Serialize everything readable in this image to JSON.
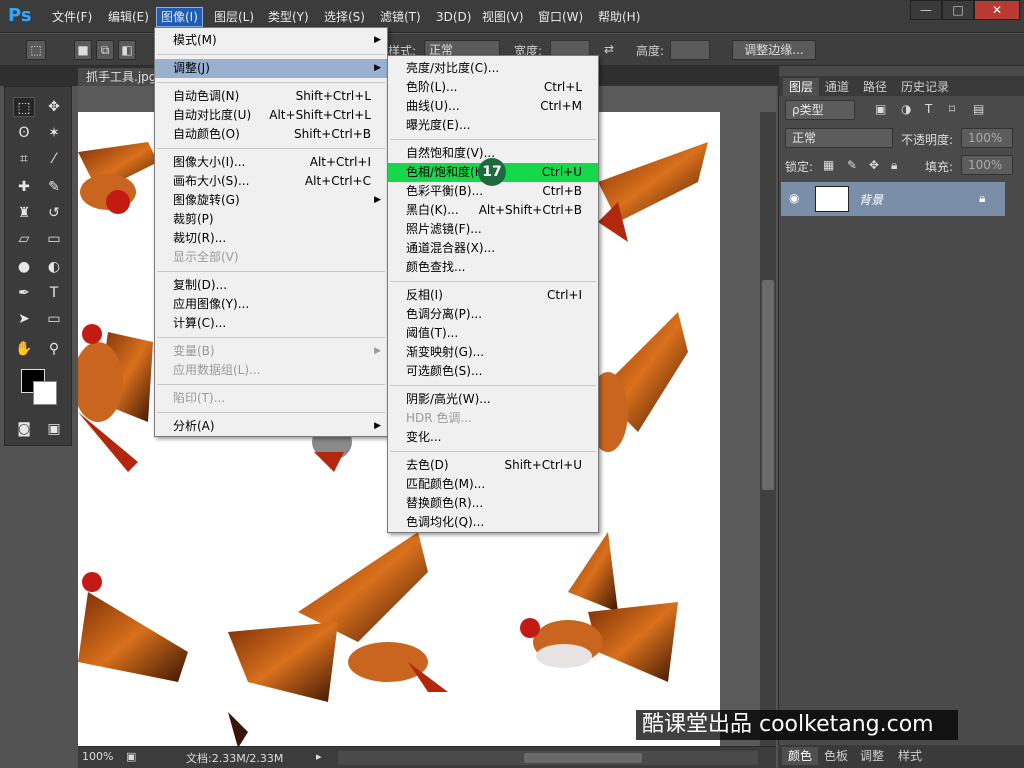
{
  "app": {
    "logo": "Ps"
  },
  "menubar": {
    "items": [
      "文件(F)",
      "编辑(E)",
      "图像(I)",
      "图层(L)",
      "类型(Y)",
      "选择(S)",
      "滤镜(T)",
      "3D(D)",
      "视图(V)",
      "窗口(W)",
      "帮助(H)"
    ],
    "active": "图像(I)"
  },
  "window_controls": {
    "minimize": "—",
    "maximize": "□",
    "close": "✕"
  },
  "options_bar": {
    "style_label": "样式:",
    "style_value": "正常",
    "width_label": "宽度:",
    "height_label": "高度:",
    "refine_button": "调整边缘..."
  },
  "document": {
    "tab_title": "抓手工具.jpg",
    "zoom": "100%",
    "doc_info": "文档:2.33M/2.33M"
  },
  "image_menu": {
    "items": [
      {
        "label": "模式(M)",
        "shortcut": "",
        "submenu": true,
        "disabled": false
      },
      {
        "sep": true
      },
      {
        "label": "调整(J)",
        "shortcut": "",
        "submenu": true,
        "disabled": false,
        "highlight": true
      },
      {
        "sep": true
      },
      {
        "label": "自动色调(N)",
        "shortcut": "Shift+Ctrl+L"
      },
      {
        "label": "自动对比度(U)",
        "shortcut": "Alt+Shift+Ctrl+L"
      },
      {
        "label": "自动颜色(O)",
        "shortcut": "Shift+Ctrl+B"
      },
      {
        "sep": true
      },
      {
        "label": "图像大小(I)...",
        "shortcut": "Alt+Ctrl+I"
      },
      {
        "label": "画布大小(S)...",
        "shortcut": "Alt+Ctrl+C"
      },
      {
        "label": "图像旋转(G)",
        "shortcut": "",
        "submenu": true
      },
      {
        "label": "裁剪(P)",
        "shortcut": ""
      },
      {
        "label": "裁切(R)...",
        "shortcut": ""
      },
      {
        "label": "显示全部(V)",
        "shortcut": "",
        "disabled": true
      },
      {
        "sep": true
      },
      {
        "label": "复制(D)...",
        "shortcut": ""
      },
      {
        "label": "应用图像(Y)...",
        "shortcut": ""
      },
      {
        "label": "计算(C)...",
        "shortcut": ""
      },
      {
        "sep": true
      },
      {
        "label": "变量(B)",
        "shortcut": "",
        "submenu": true,
        "disabled": true
      },
      {
        "label": "应用数据组(L)...",
        "shortcut": "",
        "disabled": true
      },
      {
        "sep": true
      },
      {
        "label": "陷印(T)...",
        "shortcut": "",
        "disabled": true
      },
      {
        "sep": true
      },
      {
        "label": "分析(A)",
        "shortcut": "",
        "submenu": true
      }
    ]
  },
  "adjust_menu": {
    "items": [
      {
        "label": "亮度/对比度(C)...",
        "shortcut": ""
      },
      {
        "label": "色阶(L)...",
        "shortcut": "Ctrl+L"
      },
      {
        "label": "曲线(U)...",
        "shortcut": "Ctrl+M"
      },
      {
        "label": "曝光度(E)...",
        "shortcut": ""
      },
      {
        "sep": true
      },
      {
        "label": "自然饱和度(V)...",
        "shortcut": ""
      },
      {
        "label": "色相/饱和度(H)...",
        "shortcut": "Ctrl+U",
        "green": true
      },
      {
        "label": "色彩平衡(B)...",
        "shortcut": "Ctrl+B"
      },
      {
        "label": "黑白(K)...",
        "shortcut": "Alt+Shift+Ctrl+B"
      },
      {
        "label": "照片滤镜(F)...",
        "shortcut": ""
      },
      {
        "label": "通道混合器(X)...",
        "shortcut": ""
      },
      {
        "label": "颜色查找...",
        "shortcut": ""
      },
      {
        "sep": true
      },
      {
        "label": "反相(I)",
        "shortcut": "Ctrl+I"
      },
      {
        "label": "色调分离(P)...",
        "shortcut": ""
      },
      {
        "label": "阈值(T)...",
        "shortcut": ""
      },
      {
        "label": "渐变映射(G)...",
        "shortcut": ""
      },
      {
        "label": "可选颜色(S)...",
        "shortcut": ""
      },
      {
        "sep": true
      },
      {
        "label": "阴影/高光(W)...",
        "shortcut": ""
      },
      {
        "label": "HDR 色调...",
        "shortcut": "",
        "disabled": true
      },
      {
        "label": "变化...",
        "shortcut": ""
      },
      {
        "sep": true
      },
      {
        "label": "去色(D)",
        "shortcut": "Shift+Ctrl+U"
      },
      {
        "label": "匹配颜色(M)...",
        "shortcut": ""
      },
      {
        "label": "替换颜色(R)...",
        "shortcut": ""
      },
      {
        "label": "色调均化(Q)...",
        "shortcut": ""
      }
    ]
  },
  "step_badge": "17",
  "layers_panel": {
    "tabs": [
      "图层",
      "通道",
      "路径",
      "历史记录"
    ],
    "filter_kind": "ρ类型",
    "blend_mode": "正常",
    "opacity_label": "不透明度:",
    "opacity_value": "100%",
    "lock_label": "锁定:",
    "fill_label": "填充:",
    "fill_value": "100%",
    "layer_name": "背景"
  },
  "bottom_panel_tabs": [
    "颜色",
    "色板",
    "调整",
    "样式"
  ],
  "watermark": "酷课堂出品 coolketang.com"
}
